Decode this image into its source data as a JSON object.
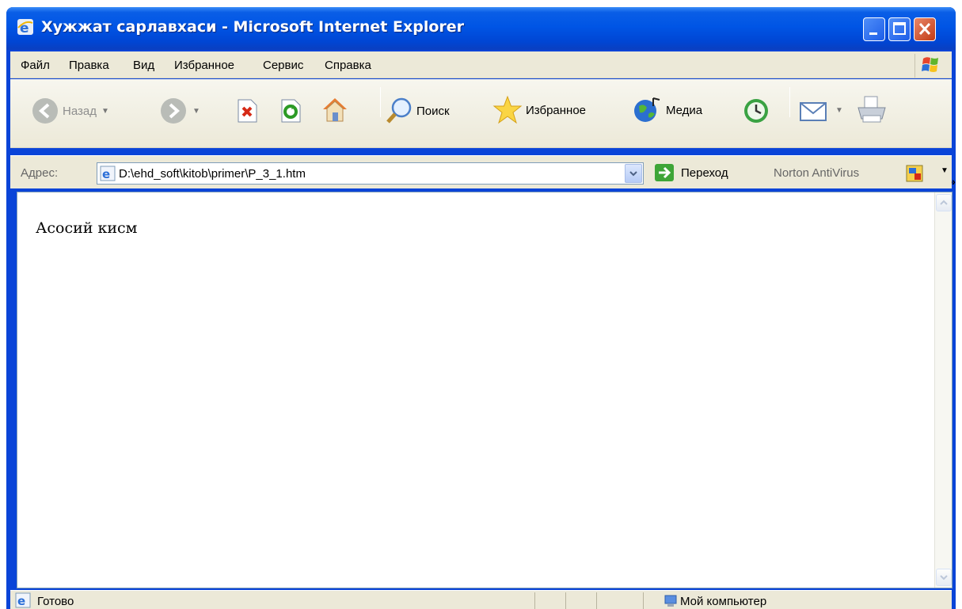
{
  "window": {
    "title": "Хужжат сарлавхаси - Microsoft Internet Explorer"
  },
  "menu": [
    "Файл",
    "Правка",
    "Вид",
    "Избранное",
    "Сервис",
    "Справка"
  ],
  "toolbar": {
    "back_label": "Назад",
    "search_label": "Поиск",
    "favorites_label": "Избранное",
    "media_label": "Медиа",
    "more": "»"
  },
  "address": {
    "label": "Адрес:",
    "value": "D:\\ehd_soft\\kitob\\primer\\P_3_1.htm",
    "go_label": "Переход",
    "norton_label": "Norton AntiVirus"
  },
  "page": {
    "text": "Асосий кисм"
  },
  "status": {
    "text": "Готово",
    "zone": "Мой компьютер"
  },
  "colors": {
    "title_blue": "#0055e5",
    "chrome": "#ece9d8"
  }
}
